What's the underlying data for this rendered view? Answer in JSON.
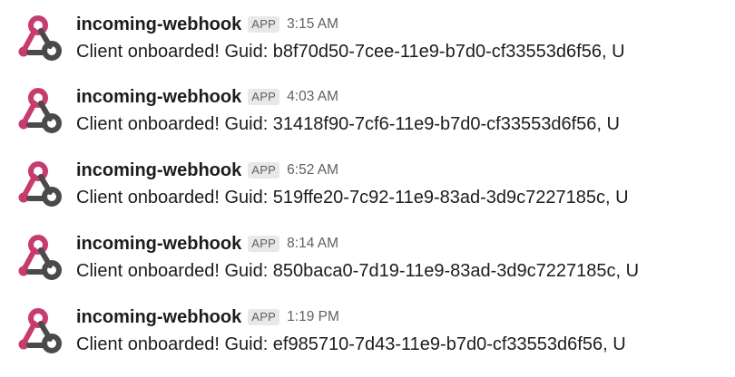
{
  "colors": {
    "icon_pink": "#c73b6f",
    "icon_dark": "#4a4a4a",
    "text": "#1d1c1d",
    "muted": "#616061",
    "badge_bg": "#e8e8e8"
  },
  "avatar_icon": "webhook-icon",
  "messages": [
    {
      "sender": "incoming-webhook",
      "badge": "APP",
      "time": "3:15 AM",
      "text": "Client onboarded! Guid: b8f70d50-7cee-11e9-b7d0-cf33553d6f56, U"
    },
    {
      "sender": "incoming-webhook",
      "badge": "APP",
      "time": "4:03 AM",
      "text": "Client onboarded! Guid: 31418f90-7cf6-11e9-b7d0-cf33553d6f56, U"
    },
    {
      "sender": "incoming-webhook",
      "badge": "APP",
      "time": "6:52 AM",
      "text": "Client onboarded! Guid: 519ffe20-7c92-11e9-83ad-3d9c7227185c, U"
    },
    {
      "sender": "incoming-webhook",
      "badge": "APP",
      "time": "8:14 AM",
      "text": "Client onboarded! Guid: 850baca0-7d19-11e9-83ad-3d9c7227185c, U"
    },
    {
      "sender": "incoming-webhook",
      "badge": "APP",
      "time": "1:19 PM",
      "text": "Client onboarded! Guid: ef985710-7d43-11e9-b7d0-cf33553d6f56, U"
    }
  ]
}
